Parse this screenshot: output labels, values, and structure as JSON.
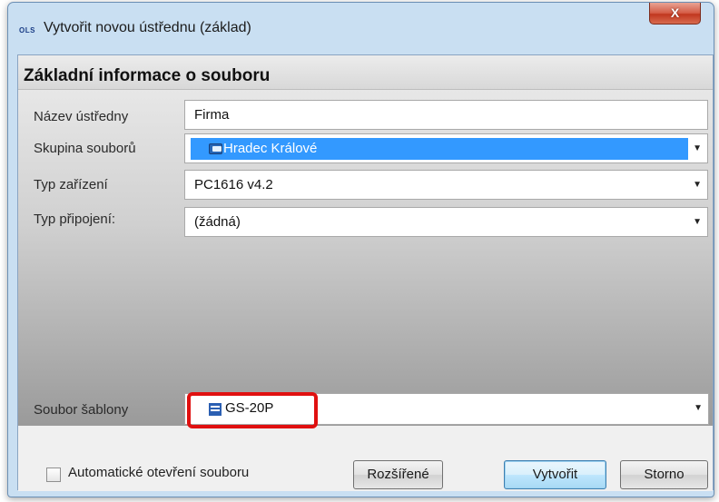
{
  "window": {
    "app_icon_text": "OLS",
    "title": "Vytvořit novou ústřednu (základ)",
    "close_label": "X"
  },
  "section": {
    "title": "Základní informace o souboru"
  },
  "form": {
    "name_label": "Název ústředny",
    "name_value": "Firma",
    "group_label": "Skupina souborů",
    "group_value": "Hradec Králové",
    "device_label": "Typ zařízení",
    "device_value": "PC1616 v4.2",
    "connection_label": "Typ připojení:",
    "connection_value": "(žádná)",
    "template_label": "Soubor šablony",
    "template_value": "GS-20P"
  },
  "footer": {
    "auto_open_label": "Automatické otevření souboru",
    "auto_open_checked": false,
    "advanced_label": "Rozšířené",
    "create_label": "Vytvořit",
    "cancel_label": "Storno"
  },
  "icons": {
    "dropdown": "chevron-down-icon",
    "group": "folder-icon",
    "template": "template-file-icon"
  },
  "colors": {
    "selection": "#3399ff",
    "highlight_border": "#e01010",
    "window_frame": "#c9dff2"
  }
}
